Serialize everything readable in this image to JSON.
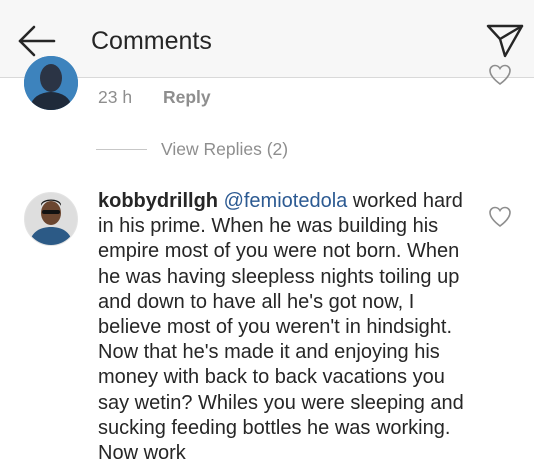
{
  "header": {
    "title": "Comments",
    "back_icon": "arrow-left-icon",
    "share_icon": "paper-plane-icon"
  },
  "previous_comment": {
    "time": "23 h",
    "reply_label": "Reply"
  },
  "view_replies": {
    "label": "View Replies (2)"
  },
  "comment": {
    "username": "kobbydrillgh",
    "mention": "@femiotedola",
    "text": " worked hard in his prime. When he was building his empire most of you were not born. When he was having sleepless nights toiling up and down to have all he's got now, I believe most of you weren't in hindsight. Now that he's made it and enjoying his money with back to back vacations you say wetin? Whiles you were sleeping and sucking feeding bottles he was working. Now work"
  },
  "colors": {
    "header_bg": "#f7f7f7",
    "text": "#262626",
    "muted": "#8e8e8e",
    "mention": "#2c5a92"
  }
}
